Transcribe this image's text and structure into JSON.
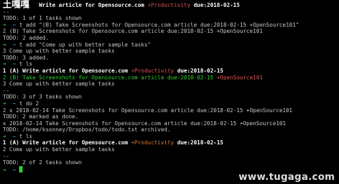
{
  "logo": "土嘎嘎",
  "watermark": "www.tugaga.com",
  "lines": [
    {
      "segs": [
        {
          "t": "           Write article for Opensource.com ",
          "c": "b"
        },
        {
          "t": "+Productivity",
          "c": "red"
        },
        {
          "t": " due:2018-02-15",
          "c": "b"
        }
      ]
    },
    {
      "segs": [
        {
          "t": "--",
          "c": "dim"
        }
      ]
    },
    {
      "segs": [
        {
          "t": "TODO: 1 of 1 tasks shown",
          "c": "dim"
        }
      ]
    },
    {
      "segs": [
        {
          "t": "➜  ",
          "c": "green"
        },
        {
          "t": "~ ",
          "c": "cyan"
        },
        {
          "t": "t add \"(B) Take Screenshots for Opensource.com article due:2018-02-15 +OpenSource101\"",
          "c": "dim"
        }
      ]
    },
    {
      "segs": [
        {
          "t": "2 (B) Take Screenshots for Opensource.com article due:2018-02-15 +OpenSource101",
          "c": "dim"
        }
      ]
    },
    {
      "segs": [
        {
          "t": "TODO: 2 added.",
          "c": "dim"
        }
      ]
    },
    {
      "segs": [
        {
          "t": "➜  ",
          "c": "green"
        },
        {
          "t": "~ ",
          "c": "cyan"
        },
        {
          "t": "t add \"Come up with better sample tasks\"",
          "c": "dim"
        }
      ]
    },
    {
      "segs": [
        {
          "t": "3 Come up with better sample tasks",
          "c": "dim"
        }
      ]
    },
    {
      "segs": [
        {
          "t": "TODO: 3 added.",
          "c": "dim"
        }
      ]
    },
    {
      "segs": [
        {
          "t": "➜  ",
          "c": "green"
        },
        {
          "t": "~ ",
          "c": "cyan"
        },
        {
          "t": "t ls",
          "c": "dim"
        }
      ]
    },
    {
      "segs": [
        {
          "t": "1 (A) Write article for Opensource.com ",
          "c": "b"
        },
        {
          "t": "+Productivity",
          "c": "red"
        },
        {
          "t": " due:2018-02-15",
          "c": "b"
        }
      ]
    },
    {
      "segs": [
        {
          "t": "2 (B) Take Screenshots for Opensource.com article due:2018-02-15 ",
          "c": "green"
        },
        {
          "t": "+OpenSource101",
          "c": "red"
        }
      ]
    },
    {
      "segs": [
        {
          "t": "3 Come up with better sample tasks",
          "c": "dim"
        }
      ]
    },
    {
      "segs": [
        {
          "t": "--",
          "c": "dim"
        }
      ]
    },
    {
      "segs": [
        {
          "t": "TODO: 3 of 3 tasks shown",
          "c": "dim"
        }
      ]
    },
    {
      "segs": [
        {
          "t": "➜  ",
          "c": "green"
        },
        {
          "t": "~ ",
          "c": "cyan"
        },
        {
          "t": "t do 2",
          "c": "dim"
        }
      ]
    },
    {
      "segs": [
        {
          "t": "2 x 2018-02-14 Take Screenshots for Opensource.com article due:2018-02-15 +OpenSource101",
          "c": "dim"
        }
      ]
    },
    {
      "segs": [
        {
          "t": "TODO: 2 marked as done.",
          "c": "dim"
        }
      ]
    },
    {
      "segs": [
        {
          "t": "x 2018-02-14 Take Screenshots for Opensource.com article due:2018-02-15 +OpenSource101",
          "c": "dim"
        }
      ]
    },
    {
      "segs": [
        {
          "t": "TODO: /home/ksonney/Dropbox/todo/todo.txt archived.",
          "c": "dim"
        }
      ]
    },
    {
      "segs": [
        {
          "t": "➜  ",
          "c": "green"
        },
        {
          "t": "~ ",
          "c": "cyan"
        },
        {
          "t": "t ls",
          "c": "dim"
        }
      ]
    },
    {
      "segs": [
        {
          "t": "1 (A) Write article for Opensource.com ",
          "c": "b"
        },
        {
          "t": "+Productivity",
          "c": "orange"
        },
        {
          "t": " due:2018-02-15",
          "c": "b"
        }
      ]
    },
    {
      "segs": [
        {
          "t": "2 Come up with better sample tasks",
          "c": "dim"
        }
      ]
    },
    {
      "segs": [
        {
          "t": "--",
          "c": "dim"
        }
      ]
    },
    {
      "segs": [
        {
          "t": "TODO: 2 of 2 tasks shown",
          "c": "dim"
        }
      ]
    },
    {
      "segs": [
        {
          "t": "➜  ",
          "c": "green"
        },
        {
          "t": "~ ",
          "c": "cyan"
        }
      ]
    }
  ]
}
